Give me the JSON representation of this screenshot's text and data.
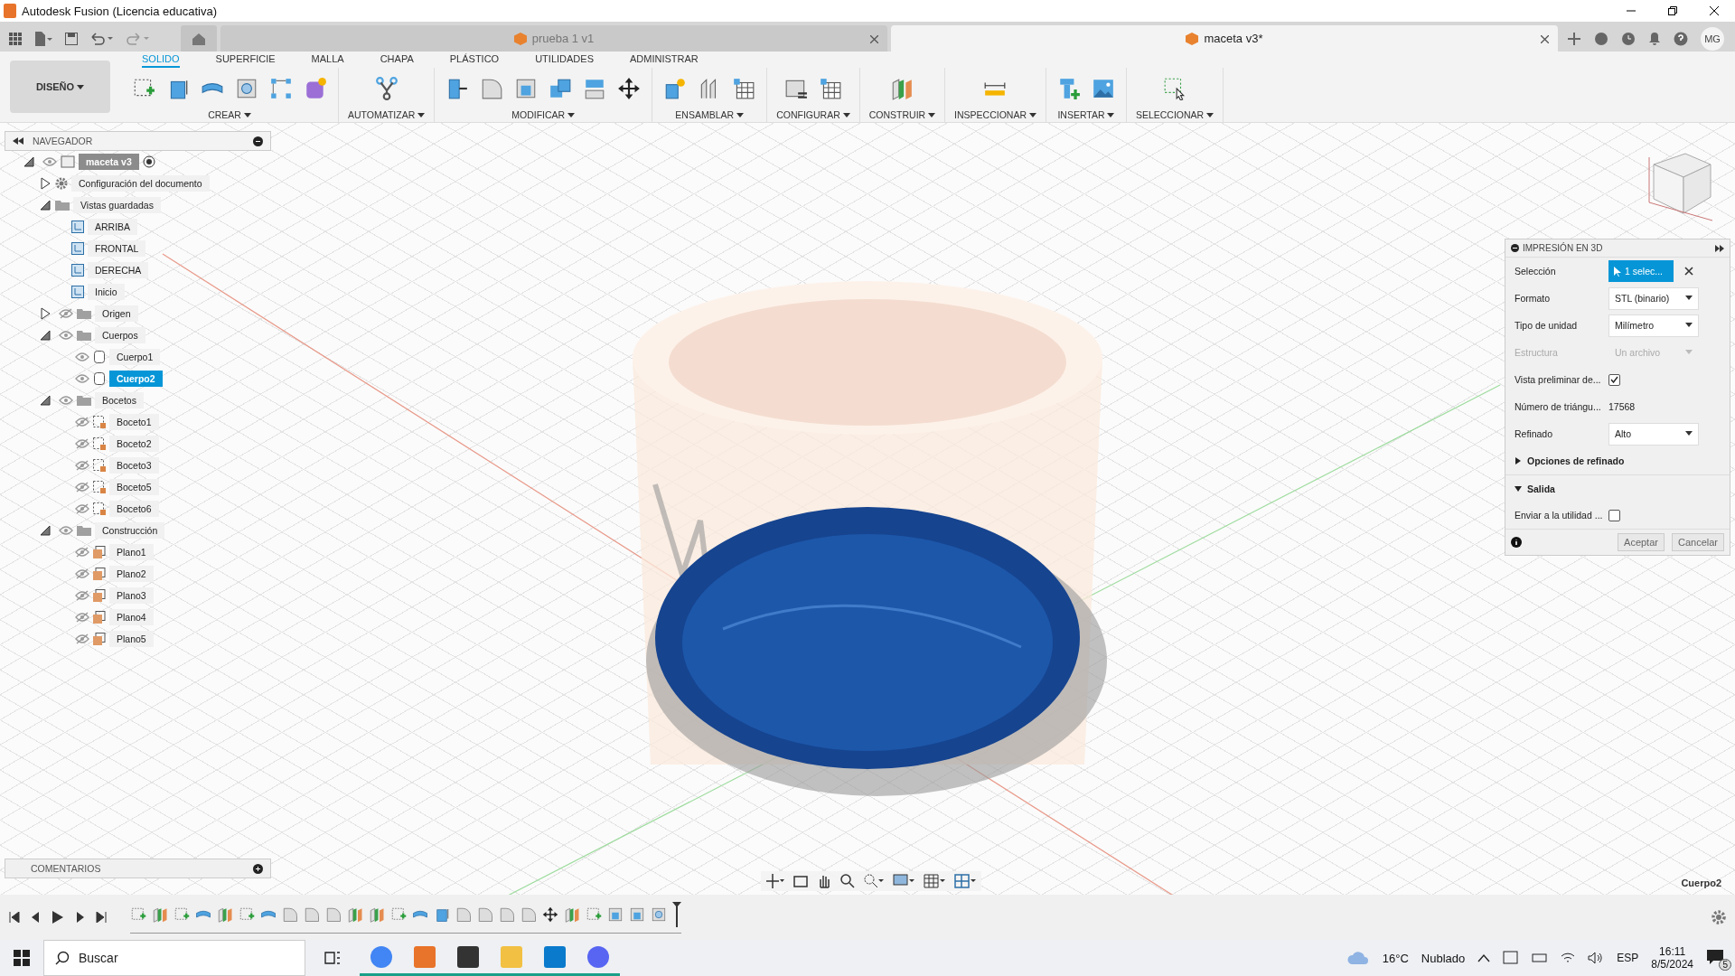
{
  "window": {
    "title": "Autodesk Fusion (Licencia educativa)"
  },
  "document_tabs": [
    {
      "label": "prueba 1 v1",
      "selected": false
    },
    {
      "label": "maceta v3*",
      "selected": true
    }
  ],
  "user_initials": "MG",
  "workspace": "DISEÑO",
  "ribbon_tabs": [
    {
      "label": "SOLIDO",
      "selected": true
    },
    {
      "label": "SUPERFICIE",
      "selected": false
    },
    {
      "label": "MALLA",
      "selected": false
    },
    {
      "label": "CHAPA",
      "selected": false
    },
    {
      "label": "PLÁSTICO",
      "selected": false
    },
    {
      "label": "UTILIDADES",
      "selected": false
    },
    {
      "label": "ADMINISTRAR",
      "selected": false
    }
  ],
  "ribbon_groups": [
    {
      "label": "CREAR"
    },
    {
      "label": "AUTOMATIZAR"
    },
    {
      "label": "MODIFICAR"
    },
    {
      "label": "ENSAMBLAR"
    },
    {
      "label": "CONFIGURAR"
    },
    {
      "label": "CONSTRUIR"
    },
    {
      "label": "INSPECCIONAR"
    },
    {
      "label": "INSERTAR"
    },
    {
      "label": "SELECCIONAR"
    }
  ],
  "navigator": {
    "title": "NAVEGADOR",
    "items": [
      {
        "kind": "component",
        "label": "maceta v3",
        "expanded": true,
        "visible": true,
        "selected": false,
        "children": [
          {
            "kind": "settings",
            "label": "Configuración del documento",
            "expanded": false,
            "selected": false
          },
          {
            "kind": "folder",
            "label": "Vistas guardadas",
            "expanded": true,
            "selected": false,
            "children": [
              {
                "kind": "view",
                "label": "ARRIBA",
                "selected": false
              },
              {
                "kind": "view",
                "label": "FRONTAL",
                "selected": false
              },
              {
                "kind": "view",
                "label": "DERECHA",
                "selected": false
              },
              {
                "kind": "view",
                "label": "Inicio",
                "selected": false
              }
            ]
          },
          {
            "kind": "folder",
            "label": "Origen",
            "expanded": false,
            "visible": false,
            "selected": false
          },
          {
            "kind": "folder",
            "label": "Cuerpos",
            "expanded": true,
            "visible": true,
            "selected": false,
            "children": [
              {
                "kind": "body",
                "label": "Cuerpo1",
                "visible": true,
                "selected": false
              },
              {
                "kind": "body",
                "label": "Cuerpo2",
                "visible": true,
                "selected": true
              }
            ]
          },
          {
            "kind": "folder",
            "label": "Bocetos",
            "expanded": true,
            "visible": true,
            "selected": false,
            "children": [
              {
                "kind": "sketch",
                "label": "Boceto1",
                "visible": false,
                "selected": false
              },
              {
                "kind": "sketch",
                "label": "Boceto2",
                "visible": false,
                "selected": false
              },
              {
                "kind": "sketch",
                "label": "Boceto3",
                "visible": false,
                "selected": false
              },
              {
                "kind": "sketch",
                "label": "Boceto5",
                "visible": false,
                "selected": false
              },
              {
                "kind": "sketch",
                "label": "Boceto6",
                "visible": false,
                "selected": false
              }
            ]
          },
          {
            "kind": "folder",
            "label": "Construcción",
            "expanded": true,
            "visible": true,
            "selected": false,
            "children": [
              {
                "kind": "plane",
                "label": "Plano1",
                "visible": false,
                "selected": false
              },
              {
                "kind": "plane",
                "label": "Plano2",
                "visible": false,
                "selected": false
              },
              {
                "kind": "plane",
                "label": "Plano3",
                "visible": false,
                "selected": false
              },
              {
                "kind": "plane",
                "label": "Plano4",
                "visible": false,
                "selected": false
              },
              {
                "kind": "plane",
                "label": "Plano5",
                "visible": false,
                "selected": false
              }
            ]
          }
        ]
      }
    ]
  },
  "comments": {
    "title": "COMENTARIOS"
  },
  "print_panel": {
    "title": "IMPRESIÓN EN 3D",
    "rows": [
      {
        "kind": "selection",
        "label": "Selección",
        "value": "1 selec..."
      },
      {
        "kind": "dropdown",
        "label": "Formato",
        "value": "STL (binario)",
        "disabled": false
      },
      {
        "kind": "dropdown",
        "label": "Tipo de unidad",
        "value": "Milímetro",
        "disabled": false
      },
      {
        "kind": "dropdown",
        "label": "Estructura",
        "value": "Un archivo",
        "disabled": true
      },
      {
        "kind": "checkbox",
        "label": "Vista preliminar de...",
        "checked": true
      },
      {
        "kind": "readout",
        "label": "Número de triángu...",
        "value": "17568"
      },
      {
        "kind": "dropdown",
        "label": "Refinado",
        "value": "Alto",
        "disabled": false
      },
      {
        "kind": "section",
        "label": "Opciones de refinado",
        "expanded": false
      },
      {
        "kind": "section",
        "label": "Salida",
        "expanded": true
      },
      {
        "kind": "checkbox",
        "label": "Enviar a la utilidad ...",
        "checked": false
      }
    ],
    "buttons": [
      "Aceptar",
      "Cancelar"
    ]
  },
  "status_text": "Cuerpo2",
  "taskbar": {
    "search_placeholder": "Buscar",
    "temperature": "16°C",
    "weather": "Nublado",
    "language": "ESP",
    "time": "16:11",
    "date": "8/5/2024",
    "notifications": "5"
  }
}
